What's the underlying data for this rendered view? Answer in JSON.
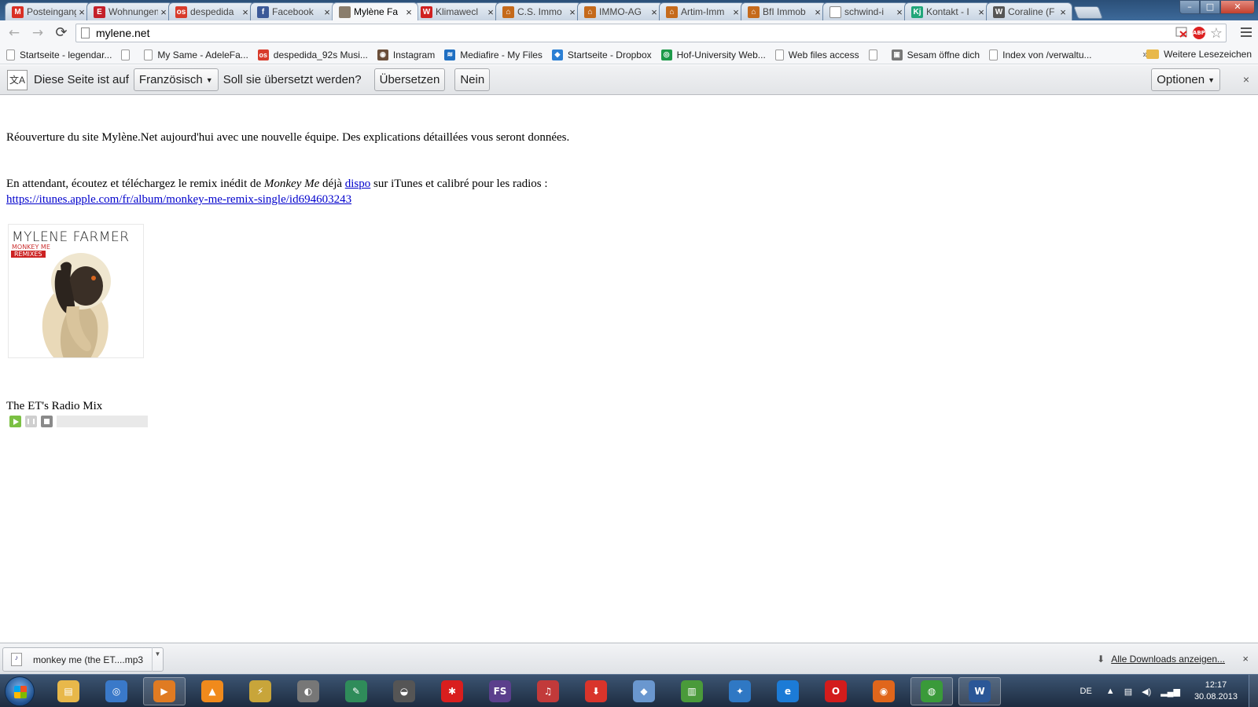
{
  "colors": {
    "accent_link": "#0000cc",
    "tabstrip_bg": "#3d6a9a",
    "taskbar_bg": "#1d2c40",
    "play_green": "#7bc043",
    "remix_red": "#cc2222"
  },
  "tabs": [
    {
      "title": "Posteingang",
      "icon": "gmail-icon",
      "icon_text": "M",
      "icon_color": "#d93025",
      "active": false
    },
    {
      "title": "Wohnungen",
      "icon": "e-site-icon",
      "icon_text": "E",
      "icon_color": "#c4202a",
      "active": false
    },
    {
      "title": "despedida",
      "icon": "os-icon",
      "icon_text": "os",
      "icon_color": "#d83b2b",
      "active": false
    },
    {
      "title": "Facebook",
      "icon": "facebook-icon",
      "icon_text": "f",
      "icon_color": "#3b5998",
      "active": false
    },
    {
      "title": "Mylène Fa",
      "icon": "mylene-icon",
      "icon_text": "",
      "icon_color": "#8a7d6c",
      "active": true
    },
    {
      "title": "Klimawecl",
      "icon": "w-site-icon",
      "icon_text": "W",
      "icon_color": "#d02020",
      "active": false
    },
    {
      "title": "C.S. Immo",
      "icon": "house-icon",
      "icon_text": "⌂",
      "icon_color": "#c56a1b",
      "active": false
    },
    {
      "title": "IMMO-AG",
      "icon": "house-icon",
      "icon_text": "⌂",
      "icon_color": "#c56a1b",
      "active": false
    },
    {
      "title": "Artim-Imm",
      "icon": "house-icon",
      "icon_text": "⌂",
      "icon_color": "#c56a1b",
      "active": false
    },
    {
      "title": "BfI Immob",
      "icon": "house-icon",
      "icon_text": "⌂",
      "icon_color": "#c56a1b",
      "active": false
    },
    {
      "title": "schwind-i",
      "icon": "page-icon",
      "icon_text": "",
      "icon_color": "#ffffff",
      "active": false
    },
    {
      "title": "Kontakt - I",
      "icon": "kj-icon",
      "icon_text": "Kj",
      "icon_color": "#21a67a",
      "active": false
    },
    {
      "title": "Coraline (F",
      "icon": "wikipedia-icon",
      "icon_text": "W",
      "icon_color": "#555555",
      "active": false
    }
  ],
  "tab_close_glyph": "×",
  "window": {
    "minimize": "–",
    "maximize": "□",
    "close": "✕"
  },
  "toolbar": {
    "back_glyph": "←",
    "forward_glyph": "→",
    "reload_glyph": "⟳",
    "url": "mylene.net",
    "abp_label": "ABP",
    "star_glyph": "☆"
  },
  "bookmarks": [
    {
      "label": "Startseite - legendar...",
      "icon": "page-icon",
      "icon_text": "",
      "icon_color": ""
    },
    {
      "label": "",
      "icon": "page-icon",
      "icon_text": "",
      "icon_color": ""
    },
    {
      "label": "My Same - AdeleFa...",
      "icon": "page-icon",
      "icon_text": "",
      "icon_color": ""
    },
    {
      "label": "despedida_92s Musi...",
      "icon": "os-icon",
      "icon_text": "os",
      "icon_color": "#d83b2b"
    },
    {
      "label": "Instagram",
      "icon": "instagram-icon",
      "icon_text": "◉",
      "icon_color": "#6b4f3a"
    },
    {
      "label": "Mediafire - My Files",
      "icon": "mediafire-icon",
      "icon_text": "≋",
      "icon_color": "#1f6fc2"
    },
    {
      "label": "Startseite - Dropbox",
      "icon": "dropbox-icon",
      "icon_text": "◆",
      "icon_color": "#2b7fd4"
    },
    {
      "label": "Hof-University Web...",
      "icon": "hof-icon",
      "icon_text": "◎",
      "icon_color": "#1e9a4a"
    },
    {
      "label": "Web files access",
      "icon": "page-icon",
      "icon_text": "",
      "icon_color": ""
    },
    {
      "label": "",
      "icon": "page-icon",
      "icon_text": "",
      "icon_color": ""
    },
    {
      "label": "Sesam öffne dich",
      "icon": "sesam-icon",
      "icon_text": "▣",
      "icon_color": "#777777"
    },
    {
      "label": "Index von /verwaltu...",
      "icon": "page-icon",
      "icon_text": "",
      "icon_color": ""
    }
  ],
  "bookmarks_more": "»",
  "bookmarks_other": "Weitere Lesezeichen",
  "translate": {
    "icon_glyph": "文A",
    "prefix": "Diese Seite ist auf",
    "language": "Französisch",
    "question": "Soll sie übersetzt werden?",
    "translate_button": "Übersetzen",
    "no_button": "Nein",
    "options_button": "Optionen",
    "close_glyph": "×"
  },
  "content": {
    "paragraph1": "Réouverture du site Mylène.Net aujourd'hui avec une nouvelle équipe. Des explications détaillées vous seront données.",
    "p2_before": "En attendant, écoutez et téléchargez le remix inédit de ",
    "p2_em": "Monkey Me",
    "p2_mid": " déjà ",
    "p2_link": "dispo",
    "p2_after": " sur iTunes et calibré pour les radios :",
    "itunes_link": "https://itunes.apple.com/fr/album/monkey-me-remix-single/id694603243",
    "cover": {
      "artist": "MYLENE FARMER",
      "album": "MONKEY ME",
      "badge": "REMIXES"
    },
    "track_title": "The ET's Radio Mix",
    "player_progress": 0
  },
  "downloads": {
    "file_name": "monkey me (the ET....mp3",
    "show_all": "Alle Downloads anzeigen...",
    "close_glyph": "×"
  },
  "taskbar": {
    "apps": [
      {
        "name": "explorer-icon",
        "glyph": "▤",
        "color": "#e8b84a",
        "running": false
      },
      {
        "name": "search-app-icon",
        "glyph": "◎",
        "color": "#3a79c9",
        "running": false
      },
      {
        "name": "media-player-icon",
        "glyph": "▶",
        "color": "#e07b22",
        "running": true
      },
      {
        "name": "vlc-icon",
        "glyph": "▲",
        "color": "#f08a1c",
        "running": false
      },
      {
        "name": "winamp-icon",
        "glyph": "⚡",
        "color": "#c8a53a",
        "running": false
      },
      {
        "name": "gimp-icon",
        "glyph": "◐",
        "color": "#777777",
        "running": false
      },
      {
        "name": "quill-icon",
        "glyph": "✎",
        "color": "#2f8c5a",
        "running": false
      },
      {
        "name": "cat-icon",
        "glyph": "◒",
        "color": "#555555",
        "running": false
      },
      {
        "name": "splash-icon",
        "glyph": "✱",
        "color": "#d91e1e",
        "running": false
      },
      {
        "name": "fs-icon",
        "glyph": "FS",
        "color": "#5b3f8c",
        "running": false
      },
      {
        "name": "mp3-icon",
        "glyph": "♫",
        "color": "#c23a3a",
        "running": false
      },
      {
        "name": "download-arrow-icon",
        "glyph": "⬇",
        "color": "#d9342b",
        "running": false
      },
      {
        "name": "cube-icon",
        "glyph": "◆",
        "color": "#6a97cf",
        "running": false
      },
      {
        "name": "chart-app-icon",
        "glyph": "▥",
        "color": "#4a9a3a",
        "running": false
      },
      {
        "name": "safari-icon",
        "glyph": "✦",
        "color": "#2f78c4",
        "running": false
      },
      {
        "name": "ie-icon",
        "glyph": "e",
        "color": "#1c7bd6",
        "running": false
      },
      {
        "name": "opera-icon",
        "glyph": "O",
        "color": "#d31c1c",
        "running": false
      },
      {
        "name": "firefox-icon",
        "glyph": "◉",
        "color": "#e0661b",
        "running": false
      },
      {
        "name": "chrome-icon",
        "glyph": "◍",
        "color": "#3a9a3a",
        "running": true
      },
      {
        "name": "word-icon",
        "glyph": "W",
        "color": "#2b5797",
        "running": true
      }
    ],
    "tray_language": "DE",
    "tray_up_glyph": "▲",
    "tray_network_glyph": "▤",
    "tray_volume_glyph": "◀)",
    "tray_signal_glyph": "▂▄▆",
    "time": "12:17",
    "date": "30.08.2013"
  }
}
